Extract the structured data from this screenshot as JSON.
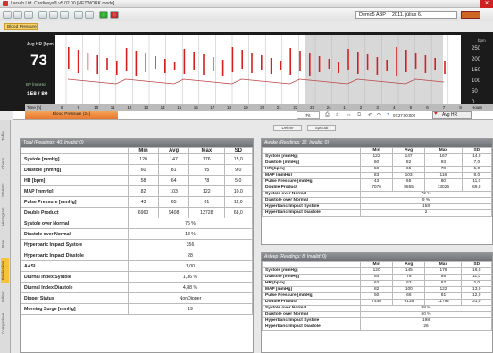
{
  "window": {
    "title": "Larsch Ltd. Cardiosys® v5.02.00 [NETWORK mode]"
  },
  "toolbar": {
    "patient_name": "Demo5 ABP",
    "patient_year": "2011. július 6."
  },
  "bp_tab": "Blood Pressure",
  "monitor": {
    "hr_label": "Avg HR [bpm]",
    "hr_value": "73",
    "bp_label": "BP [mmHg]",
    "bp_value": "158 / 80",
    "time_label": "Time [h]",
    "right_unit": "bpm",
    "y_ticks": [
      "250",
      "200",
      "150",
      "100",
      "50",
      "0"
    ],
    "hours_label": "Hours",
    "time_ticks": [
      "8",
      "9",
      "10",
      "11",
      "12",
      "13",
      "14",
      "15",
      "16",
      "17",
      "18",
      "19",
      "20",
      "21",
      "22",
      "23",
      "24",
      "1",
      "2",
      "3",
      "4",
      "5",
      "6",
      "7",
      "8"
    ]
  },
  "filterbar": {
    "bp_select": "Blood Pressure (24)",
    "zoom": "Fit",
    "clock": "07:27:00:000",
    "hr_select": "Avg HR"
  },
  "actions": {
    "btn1": "Delete",
    "btn2": "Special"
  },
  "sidebar": {
    "tabs": [
      "Table",
      "Charts",
      "Statistic",
      "Histogram",
      "Raw",
      "Evaluation",
      "Editor",
      "Comparison"
    ]
  },
  "total": {
    "header": "Total (Readings: 40, Invalid: 0)",
    "cols": [
      "Min",
      "Avg",
      "Max",
      "SD"
    ],
    "rows": [
      [
        "Systole [mmHg]",
        "120",
        "147",
        "176",
        "15,0"
      ],
      [
        "Diastole [mmHg]",
        "60",
        "81",
        "95",
        "9,0"
      ],
      [
        "HR [bpm]",
        "58",
        "64",
        "78",
        "5,0"
      ],
      [
        "MAP [mmHg]",
        "82",
        "103",
        "122",
        "10,0"
      ],
      [
        "Pulse Pressure [mmHg]",
        "43",
        "65",
        "81",
        "11,0"
      ],
      [
        "Double Product",
        "6960",
        "9408",
        "13728",
        "68,0"
      ]
    ],
    "span_rows": [
      [
        "Systole over Normal",
        "75 %"
      ],
      [
        "Diastole over Normal",
        "18 %"
      ],
      [
        "Hyperbaric Impact Systole",
        "356"
      ],
      [
        "Hyperbaric Impact Diastole",
        "28"
      ],
      [
        "AASI",
        "1,00"
      ],
      [
        "Diurnal Index Systole",
        "1,36 %"
      ],
      [
        "Diurnal Index Diastole",
        "4,88 %"
      ],
      [
        "Dipper Status",
        "NonDipper"
      ],
      [
        "Morning Surge [mmHg]",
        "19"
      ]
    ]
  },
  "awake": {
    "header": "Awake (Readings: 32, Invalid: 0)",
    "cols": [
      "Min",
      "Avg",
      "Max",
      "SD"
    ],
    "rows": [
      [
        "Systole [mmHg]",
        "122",
        "147",
        "167",
        "14,0"
      ],
      [
        "Diastole [mmHg]",
        "60",
        "82",
        "93",
        "7,0"
      ],
      [
        "HR [bpm]",
        "58",
        "65",
        "78",
        "5,0"
      ],
      [
        "MAP [mmHg]",
        "83",
        "103",
        "116",
        "8,0"
      ],
      [
        "Pulse Pressure [mmHg]",
        "43",
        "65",
        "80",
        "11,0"
      ],
      [
        "Double Product",
        "7076",
        "9555",
        "13026",
        "69,0"
      ]
    ],
    "span_rows": [
      [
        "Systole over Normal",
        "72 %"
      ],
      [
        "Diastole over Normal",
        "9 %"
      ],
      [
        "Hyperbaric Impact Systole",
        "158"
      ],
      [
        "Hyperbaric Impact Diastole",
        "2"
      ]
    ]
  },
  "asleep": {
    "header": "Asleep (Readings: 8, Invalid: 0)",
    "cols": [
      "Min",
      "Avg",
      "Max",
      "SD"
    ],
    "rows": [
      [
        "Systole [mmHg]",
        "120",
        "145",
        "176",
        "18,0"
      ],
      [
        "Diastole [mmHg]",
        "64",
        "78",
        "95",
        "11,0"
      ],
      [
        "HR [bpm]",
        "62",
        "63",
        "67",
        "2,0"
      ],
      [
        "MAP [mmHg]",
        "82",
        "100",
        "122",
        "13,0"
      ],
      [
        "Pulse Pressure [mmHg]",
        "50",
        "66",
        "81",
        "12,0"
      ],
      [
        "Double Product",
        "7440",
        "9135",
        "11792",
        "31,0"
      ]
    ],
    "span_rows": [
      [
        "Systole over Normal",
        "88 %"
      ],
      [
        "Diastole over Normal",
        "50 %"
      ],
      [
        "Hyperbaric Impact Systole",
        "198"
      ],
      [
        "Hyperbaric Impact Diastole",
        "26"
      ]
    ]
  }
}
